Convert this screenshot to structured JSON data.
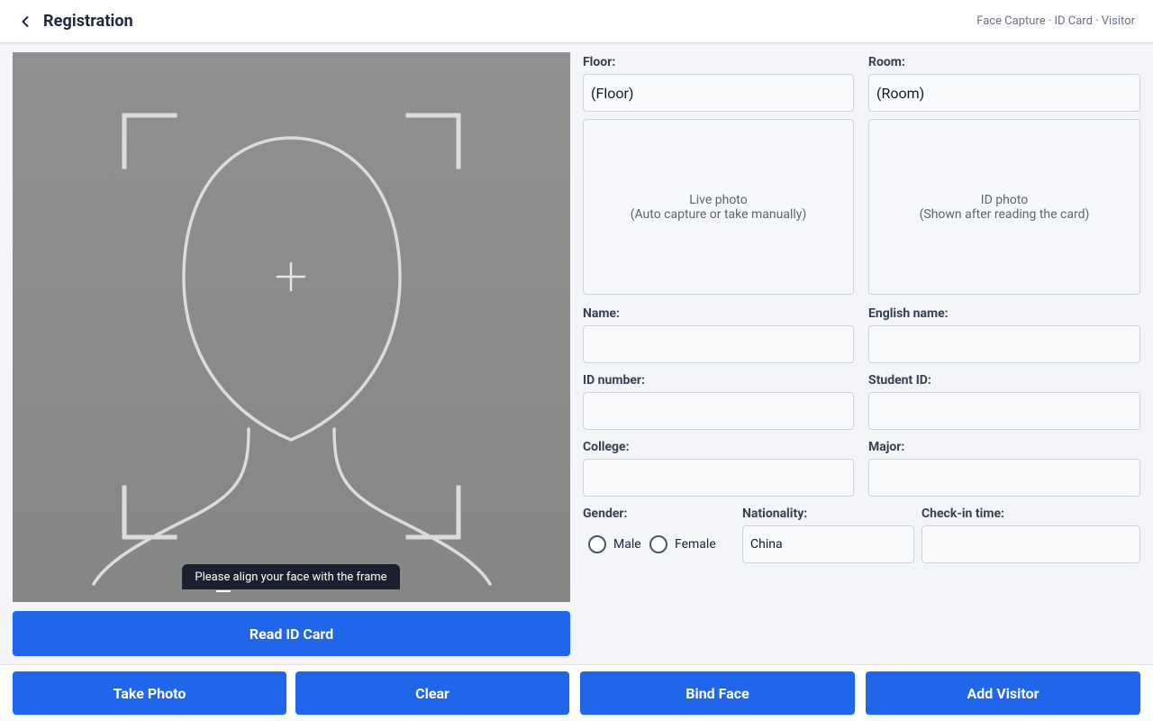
{
  "header": {
    "title": "Registration",
    "breadcrumb": "Face Capture · ID Card · Visitor"
  },
  "camera": {
    "hint": "Please align your face with the frame"
  },
  "buttons": {
    "read_id_card": "Read ID Card",
    "take_photo": "Take Photo",
    "clear": "Clear",
    "bind_face": "Bind Face",
    "add_visitor": "Add Visitor"
  },
  "form": {
    "floor": {
      "label": "Floor:",
      "value": "(Floor)"
    },
    "room": {
      "label": "Room:",
      "value": "(Room)"
    },
    "live_photo": {
      "line1": "Live photo",
      "line2": "(Auto capture or take manually)"
    },
    "id_photo": {
      "line1": "ID photo",
      "line2": "(Shown after reading the card)"
    },
    "name": {
      "label": "Name:",
      "value": ""
    },
    "english_name": {
      "label": "English name:",
      "value": ""
    },
    "id_number": {
      "label": "ID number:",
      "value": ""
    },
    "student_id": {
      "label": "Student ID:",
      "value": ""
    },
    "college": {
      "label": "College:",
      "value": ""
    },
    "major": {
      "label": "Major:",
      "value": ""
    },
    "gender": {
      "label": "Gender:",
      "options": [
        "Male",
        "Female"
      ],
      "selected": ""
    },
    "nationality": {
      "label": "Nationality:",
      "value": "China"
    },
    "checkin_time": {
      "label": "Check-in time:",
      "value": ""
    }
  },
  "colors": {
    "primary": "#1f66eb",
    "hint_bg": "#1a2030"
  }
}
